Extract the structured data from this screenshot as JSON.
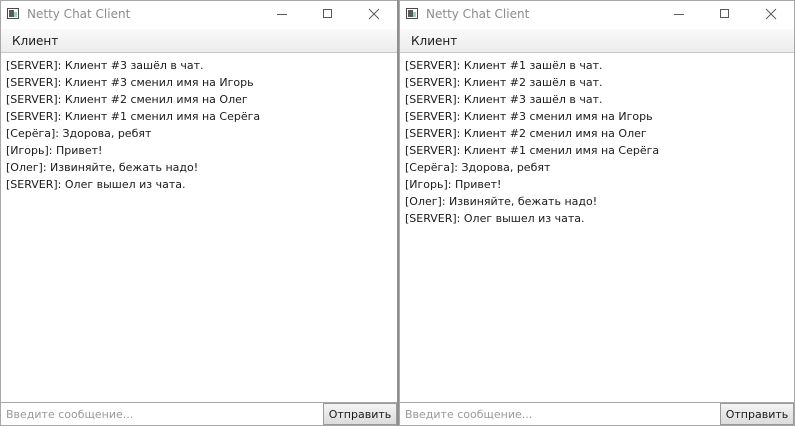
{
  "left_window": {
    "title": "Netty Chat Client",
    "menu": [
      "Клиент"
    ],
    "messages": [
      "[SERVER]: Клиент #3 зашёл в чат.",
      "[SERVER]: Клиент #3 сменил имя на Игорь",
      "[SERVER]: Клиент #2 сменил имя на Олег",
      "[SERVER]: Клиент #1 сменил имя на Серёга",
      "[Серёга]: Здорова, ребят",
      "[Игорь]: Привет!",
      "[Олег]: Извиняйте, бежать надо!",
      "[SERVER]: Олег вышел из чата."
    ],
    "input_placeholder": "Введите сообщение...",
    "input_value": "",
    "send_label": "Отправить"
  },
  "right_window": {
    "title": "Netty Chat Client",
    "menu": [
      "Клиент"
    ],
    "messages": [
      "[SERVER]: Клиент #1 зашёл в чат.",
      "[SERVER]: Клиент #2 зашёл в чат.",
      "[SERVER]: Клиент #3 зашёл в чат.",
      "[SERVER]: Клиент #3 сменил имя на Игорь",
      "[SERVER]: Клиент #2 сменил имя на Олег",
      "[SERVER]: Клиент #1 сменил имя на Серёга",
      "[Серёга]: Здорова, ребят",
      "[Игорь]: Привет!",
      "[Олег]: Извиняйте, бежать надо!",
      "[SERVER]: Олег вышел из чата."
    ],
    "input_placeholder": "Введите сообщение...",
    "input_value": "",
    "send_label": "Отправить"
  },
  "icons": {
    "app": "app-window-icon",
    "minimize": "minimize-icon",
    "maximize": "maximize-icon",
    "close": "close-icon"
  },
  "colors": {
    "title_text": "#8c8c8c",
    "menubar": "#ececec",
    "divider": "#8f8f8f"
  }
}
